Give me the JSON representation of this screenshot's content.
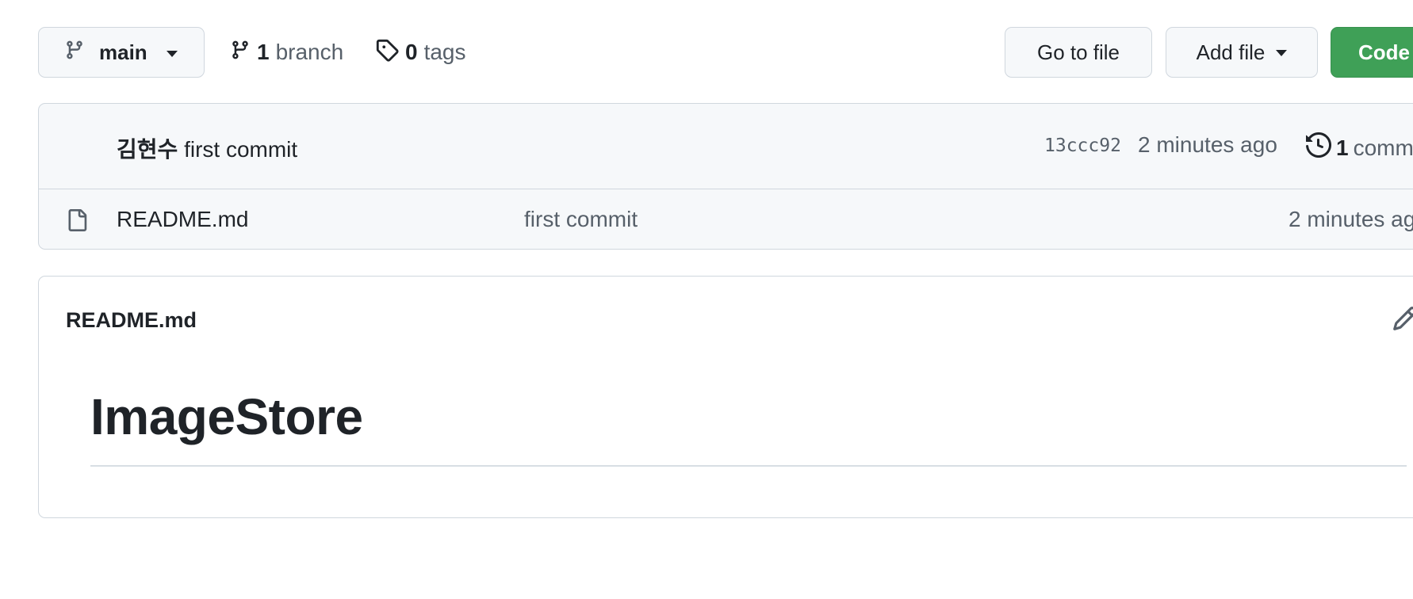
{
  "toolbar": {
    "branch_selector": "main",
    "branches_count": "1",
    "branches_label": "branch",
    "tags_count": "0",
    "tags_label": "tags",
    "go_to_file": "Go to file",
    "add_file": "Add file",
    "code": "Code"
  },
  "latest_commit": {
    "author": "김현수",
    "message": "first commit",
    "sha": "13ccc92",
    "time": "2 minutes ago",
    "commits_count": "1",
    "commits_label": "comm"
  },
  "files": [
    {
      "name": "README.md",
      "commit": "first commit",
      "time": "2 minutes ag",
      "icon": "file-icon"
    }
  ],
  "readme": {
    "title": "README.md",
    "heading": "ImageStore"
  },
  "colors": {
    "code_button": "#3fa057",
    "border": "#d0d7de",
    "muted_text": "#57606a",
    "panel_bg": "#f6f8fa"
  }
}
